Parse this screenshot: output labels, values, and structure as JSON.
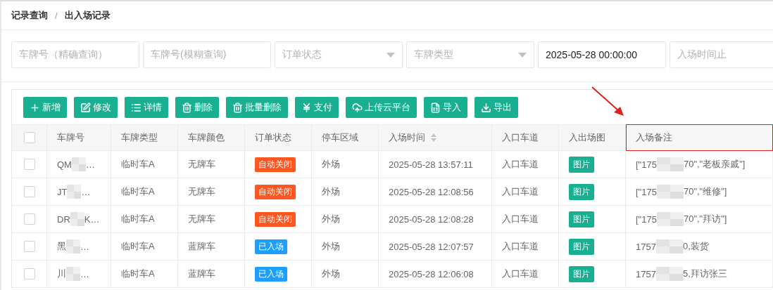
{
  "breadcrumb": [
    "记录查询",
    "出入场记录"
  ],
  "breadcrumb_separator": "/",
  "filters": [
    {
      "kind": "text",
      "placeholder": "车牌号（精确查询）"
    },
    {
      "kind": "text",
      "placeholder": "车牌号(模糊查询)"
    },
    {
      "kind": "select",
      "placeholder": "订单状态"
    },
    {
      "kind": "select",
      "placeholder": "车牌类型"
    },
    {
      "kind": "text",
      "value": "2025-05-28 00:00:00"
    },
    {
      "kind": "text",
      "placeholder": "入场时间止"
    }
  ],
  "toolbar": [
    {
      "label": "新增"
    },
    {
      "label": "修改"
    },
    {
      "label": "详情"
    },
    {
      "label": "删除"
    },
    {
      "label": "批量删除"
    },
    {
      "label": "支付"
    },
    {
      "label": "上传云平台"
    },
    {
      "label": "导入"
    },
    {
      "label": "导出"
    }
  ],
  "table": {
    "select_all_checked": false,
    "columns": [
      {
        "label": "车牌号",
        "sortable": false,
        "highlighted": false
      },
      {
        "label": "车牌类型",
        "sortable": false,
        "highlighted": false
      },
      {
        "label": "车牌颜色",
        "sortable": false,
        "highlighted": false
      },
      {
        "label": "订单状态",
        "sortable": false,
        "highlighted": false
      },
      {
        "label": "停车区域",
        "sortable": false,
        "highlighted": false
      },
      {
        "label": "入场时间",
        "sortable": true,
        "highlighted": false
      },
      {
        "label": "入口车道",
        "sortable": false,
        "highlighted": false
      },
      {
        "label": "入出场图",
        "sortable": false,
        "highlighted": false
      },
      {
        "label": "入场备注",
        "sortable": false,
        "highlighted": true
      }
    ],
    "rows": [
      {
        "checked": false,
        "plate_start": "QM",
        "plate_end": "…",
        "type": "临时车A",
        "plate_color": "无牌车",
        "status": {
          "label": "自动关闭",
          "kind": "closed"
        },
        "area": "外场",
        "time": "2025-05-28 13:57:11",
        "lane": "入口车道",
        "image": "图片",
        "note_start": "[\"175",
        "note_end": "70\",\"老板亲戚\"]"
      },
      {
        "checked": false,
        "plate_start": "JT",
        "plate_end": "…",
        "type": "临时车A",
        "plate_color": "无牌车",
        "status": {
          "label": "自动关闭",
          "kind": "closed"
        },
        "area": "外场",
        "time": "2025-05-28 12:08:56",
        "lane": "入口车道",
        "image": "图片",
        "note_start": "[\"175",
        "note_end": "70\",\"维修\"]"
      },
      {
        "checked": false,
        "plate_start": "DR",
        "plate_end": "K…",
        "type": "临时车A",
        "plate_color": "无牌车",
        "status": {
          "label": "自动关闭",
          "kind": "closed"
        },
        "area": "外场",
        "time": "2025-05-28 12:08:28",
        "lane": "入口车道",
        "image": "图片",
        "note_start": "[\"175",
        "note_end": "70\",\"拜访\"]"
      },
      {
        "checked": false,
        "plate_start": "黑",
        "plate_end": "…",
        "type": "临时车A",
        "plate_color": "蓝牌车",
        "status": {
          "label": "已入场",
          "kind": "entered"
        },
        "area": "外场",
        "time": "2025-05-28 12:07:57",
        "lane": "入口车道",
        "image": "图片",
        "note_start": "1757",
        "note_end": "0,装货"
      },
      {
        "checked": false,
        "plate_start": "川",
        "plate_end": "…",
        "type": "临时车A",
        "plate_color": "蓝牌车",
        "status": {
          "label": "已入场",
          "kind": "entered"
        },
        "area": "外场",
        "time": "2025-05-28 12:06:08",
        "lane": "入口车道",
        "image": "图片",
        "note_start": "1757",
        "note_end": "5,拜访张三"
      }
    ]
  }
}
